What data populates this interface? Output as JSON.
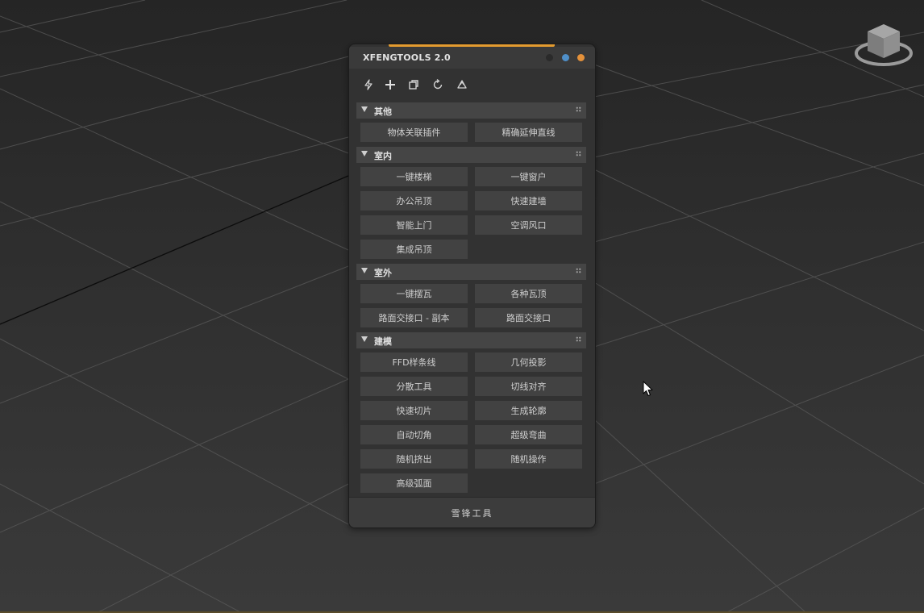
{
  "window": {
    "title": "XFENGTOOLS  2.0"
  },
  "colors": {
    "accent": "#e39b2f",
    "dot_blue": "#4f8fc8",
    "dot_orange": "#e4913a"
  },
  "toolbar": {
    "icons": [
      "lightning-icon",
      "plus-icon",
      "copy-icon",
      "refresh-icon",
      "recycle-icon"
    ]
  },
  "sections": [
    {
      "title": "其他",
      "buttons": [
        "物体关联插件",
        "精确延伸直线"
      ]
    },
    {
      "title": "室内",
      "buttons": [
        "一键楼梯",
        "一键窗户",
        "办公吊顶",
        "快速建墙",
        "智能上门",
        "空调风口",
        "集成吊顶"
      ]
    },
    {
      "title": "室外",
      "buttons": [
        "一键摆瓦",
        "各种瓦顶",
        "路面交接口 - 副本",
        "路面交接口"
      ]
    },
    {
      "title": "建模",
      "buttons": [
        "FFD样条线",
        "几何投影",
        "分散工具",
        "切线对齐",
        "快速切片",
        "生成轮廓",
        "自动切角",
        "超级弯曲",
        "随机挤出",
        "随机操作",
        "高级弧面"
      ]
    }
  ],
  "footer": {
    "label": "雪锋工具"
  }
}
